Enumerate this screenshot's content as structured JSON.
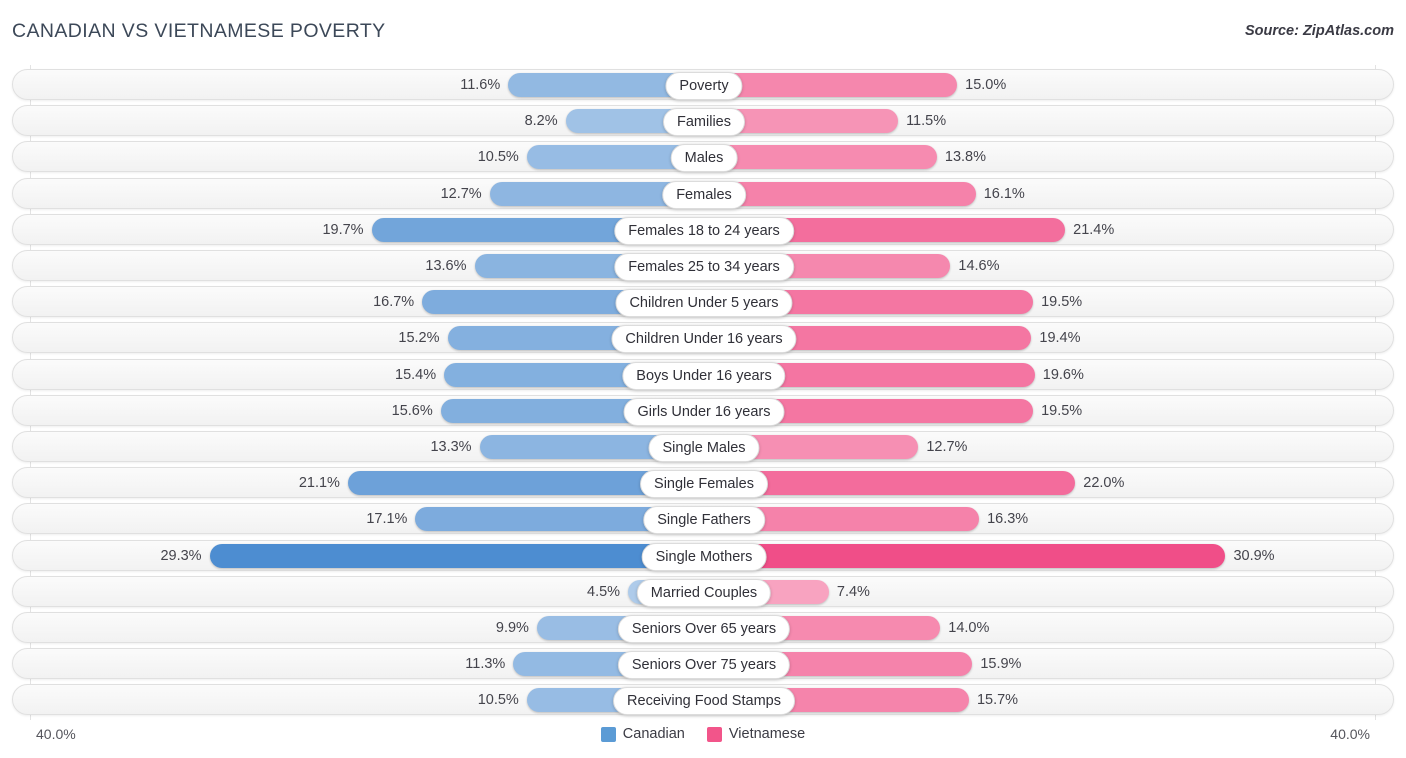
{
  "header": {
    "title": "CANADIAN VS VIETNAMESE POVERTY",
    "source": "Source: ZipAtlas.com"
  },
  "axis": {
    "left_tick": "40.0%",
    "right_tick": "40.0%"
  },
  "legend": {
    "items": [
      {
        "label": "Canadian",
        "color": "#5B9BD5"
      },
      {
        "label": "Vietnamese",
        "color": "#F2558A"
      }
    ]
  },
  "colors": {
    "canadian": "#5B9BD5",
    "vietnamese": "#F2558A",
    "track": "#f4f4f4",
    "gridline": "#e3e3e3"
  },
  "chart_data": {
    "type": "bar",
    "orientation": "horizontal-diverging",
    "title": "CANADIAN VS VIETNAMESE POVERTY",
    "xlabel": "",
    "ylabel": "",
    "xlim": [
      0,
      40
    ],
    "axis_max_percent": 40.0,
    "grid": true,
    "legend_position": "bottom-center",
    "categories": [
      "Poverty",
      "Families",
      "Males",
      "Females",
      "Females 18 to 24 years",
      "Females 25 to 34 years",
      "Children Under 5 years",
      "Children Under 16 years",
      "Boys Under 16 years",
      "Girls Under 16 years",
      "Single Males",
      "Single Females",
      "Single Fathers",
      "Single Mothers",
      "Married Couples",
      "Seniors Over 65 years",
      "Seniors Over 75 years",
      "Receiving Food Stamps"
    ],
    "series": [
      {
        "name": "Canadian",
        "color": "#5B9BD5",
        "values": [
          11.6,
          8.2,
          10.5,
          12.7,
          19.7,
          13.6,
          16.7,
          15.2,
          15.4,
          15.6,
          13.3,
          21.1,
          17.1,
          29.3,
          4.5,
          9.9,
          11.3,
          10.5
        ],
        "labels": [
          "11.6%",
          "8.2%",
          "10.5%",
          "12.7%",
          "19.7%",
          "13.6%",
          "16.7%",
          "15.2%",
          "15.4%",
          "15.6%",
          "13.3%",
          "21.1%",
          "17.1%",
          "29.3%",
          "4.5%",
          "9.9%",
          "11.3%",
          "10.5%"
        ]
      },
      {
        "name": "Vietnamese",
        "color": "#F2558A",
        "values": [
          15.0,
          11.5,
          13.8,
          16.1,
          21.4,
          14.6,
          19.5,
          19.4,
          19.6,
          19.5,
          12.7,
          22.0,
          16.3,
          30.9,
          7.4,
          14.0,
          15.9,
          15.7
        ],
        "labels": [
          "15.0%",
          "11.5%",
          "13.8%",
          "16.1%",
          "21.4%",
          "14.6%",
          "19.5%",
          "19.4%",
          "19.6%",
          "19.5%",
          "12.7%",
          "22.0%",
          "16.3%",
          "30.9%",
          "7.4%",
          "14.0%",
          "15.9%",
          "15.7%"
        ]
      }
    ]
  }
}
